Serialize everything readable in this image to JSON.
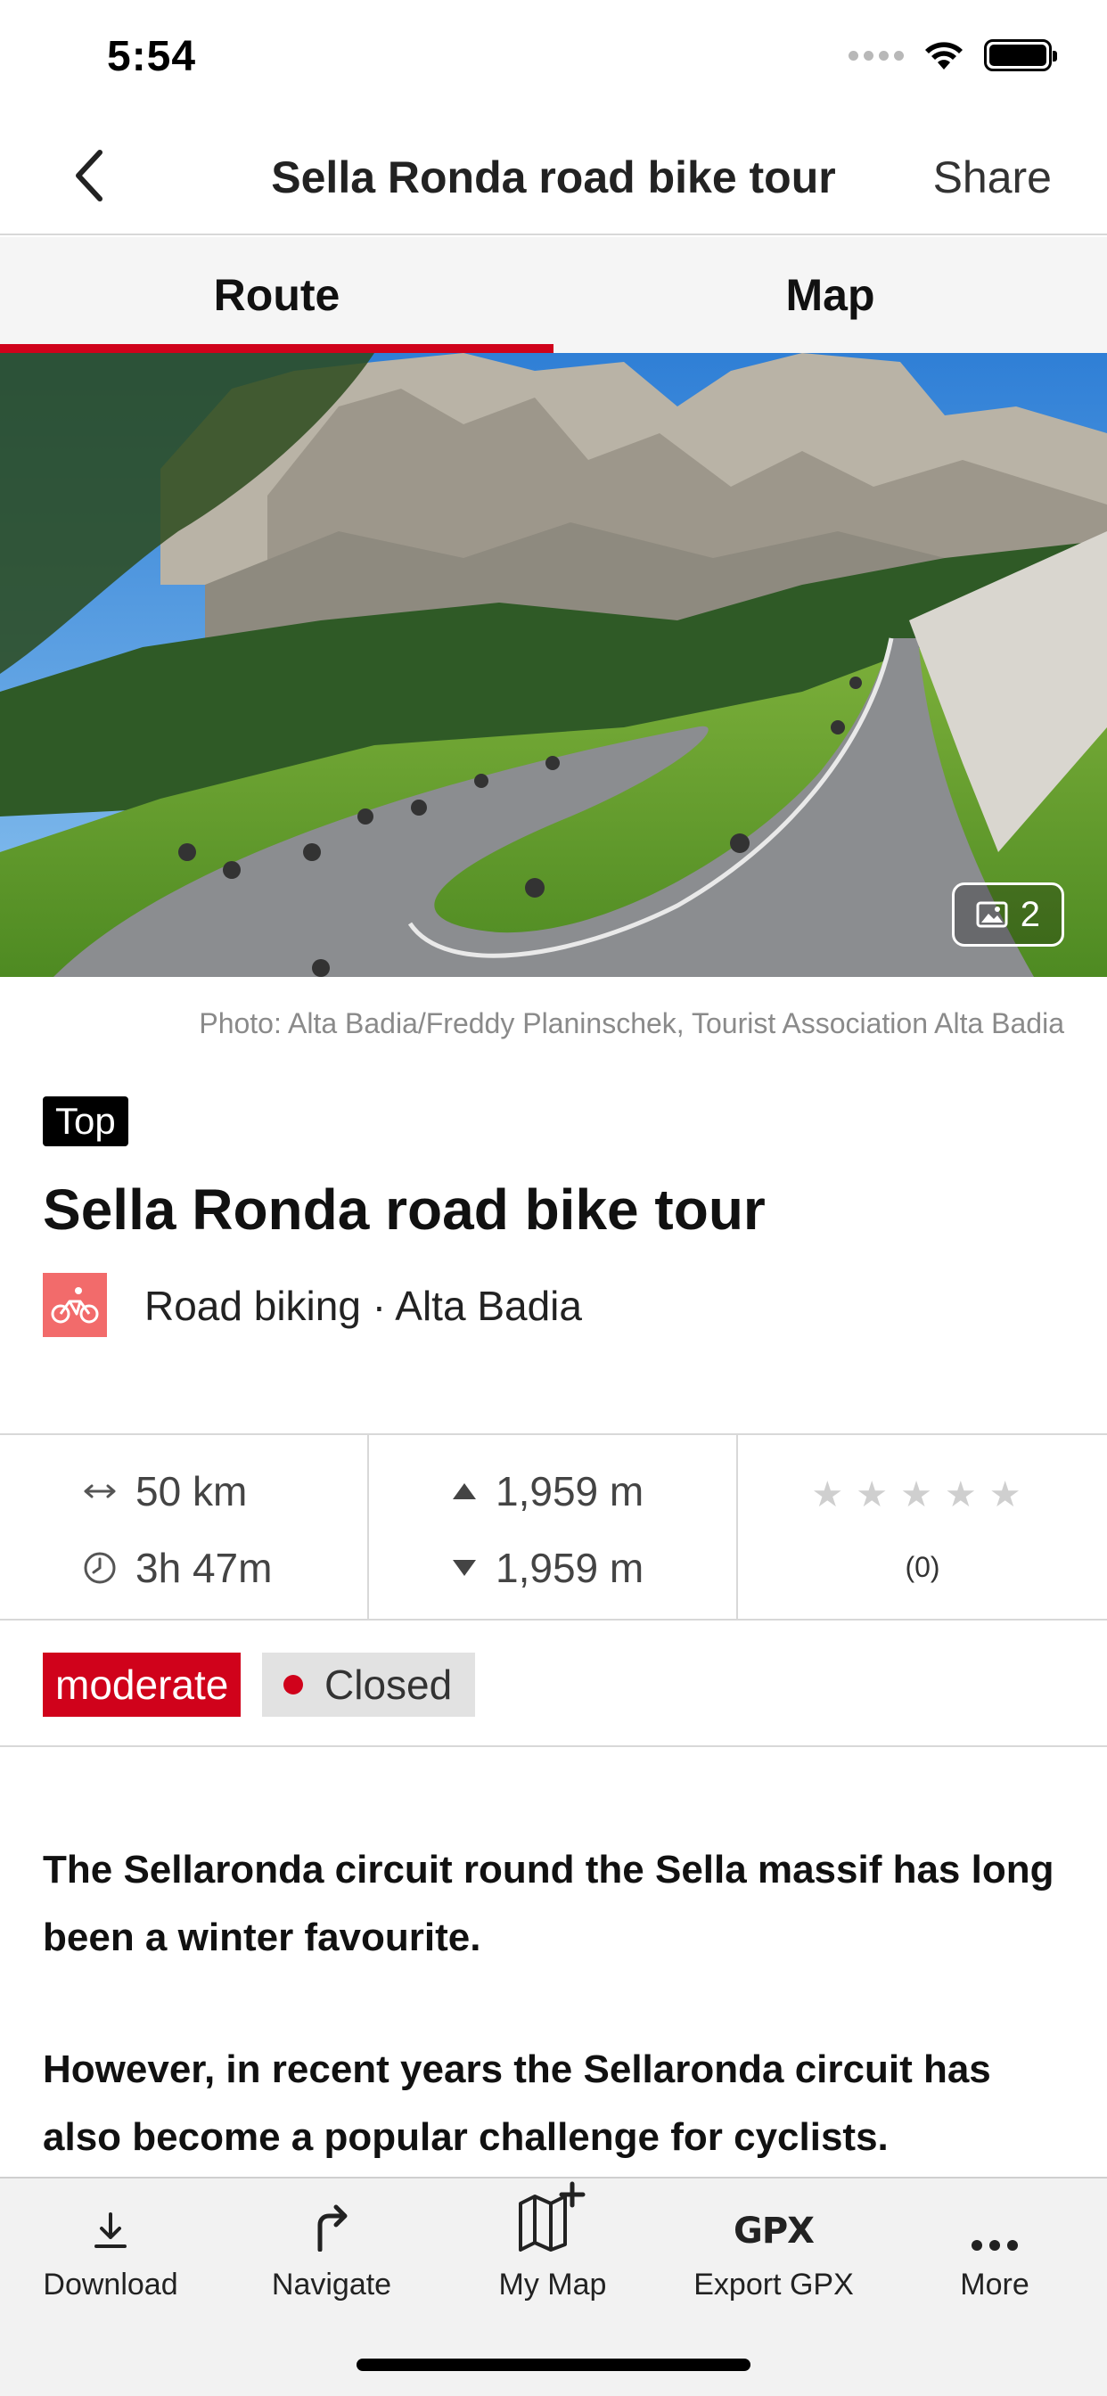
{
  "status_bar": {
    "time": "5:54"
  },
  "nav": {
    "title": "Sella Ronda road bike tour",
    "share": "Share"
  },
  "tabs": [
    {
      "label": "Route",
      "active": true
    },
    {
      "label": "Map",
      "active": false
    }
  ],
  "hero": {
    "photo_count": "2"
  },
  "photo_credit": "Photo: Alta Badia/Freddy Planinschek, Tourist Association Alta Badia",
  "badge": "Top",
  "tour": {
    "title": "Sella Ronda road bike tour",
    "activity": "Road biking · Alta Badia"
  },
  "stats": {
    "distance": "50 km",
    "duration": "3h 47m",
    "ascent": "1,959 m",
    "descent": "1,959 m",
    "stars": "★★★★★",
    "rating_count": "(0)"
  },
  "tags": {
    "difficulty": "moderate",
    "status": "Closed"
  },
  "description": [
    "The Sellaronda circuit round the Sella massif has long been a winter favourite.",
    "However, in recent years the Sellaronda circuit has also become a popular challenge for cyclists."
  ],
  "toolbar": [
    {
      "label": "Download",
      "icon": "download-icon"
    },
    {
      "label": "Navigate",
      "icon": "navigate-icon"
    },
    {
      "label": "My Map",
      "icon": "my-map-icon"
    },
    {
      "label": "Export GPX",
      "icon": "gpx-icon",
      "icon_text": "GPX"
    },
    {
      "label": "More",
      "icon": "more-icon"
    }
  ],
  "colors": {
    "accent": "#d0021b",
    "activity_icon_bg": "#f26b6b",
    "tab_bg": "#f5f5f5",
    "toolbar_bg": "#f2f2f2"
  }
}
